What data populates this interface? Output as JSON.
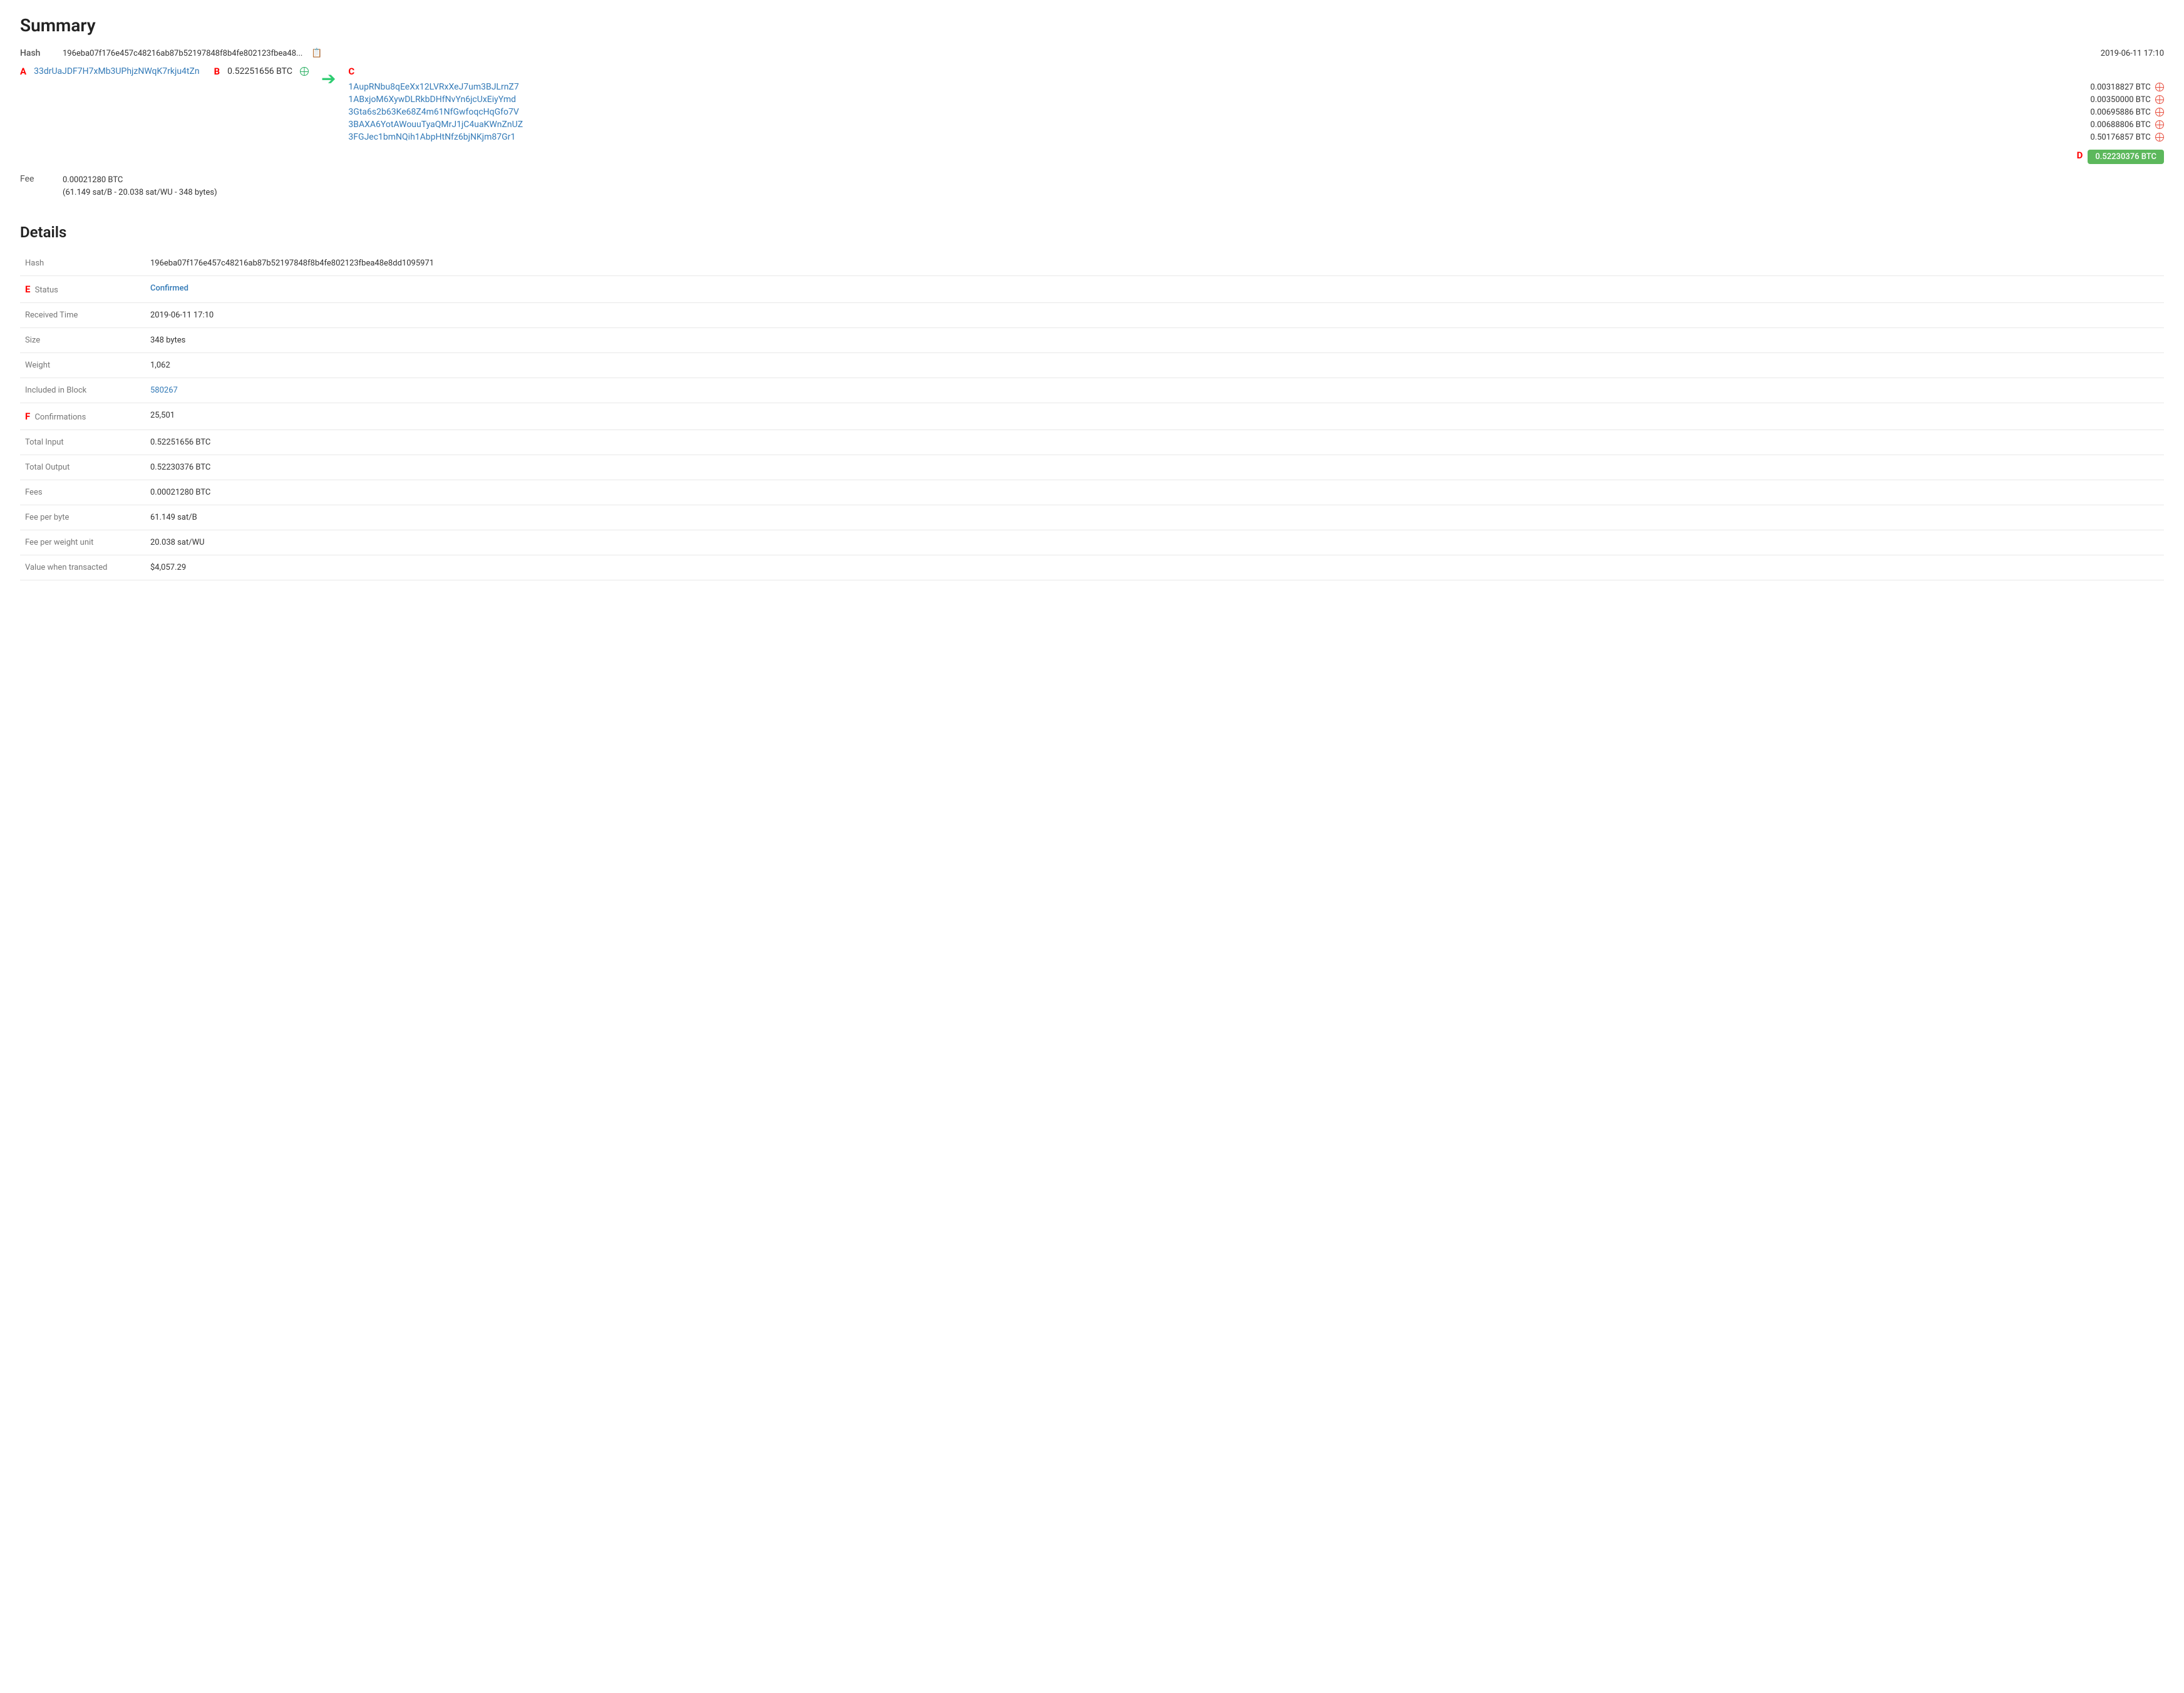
{
  "summary": {
    "title": "Summary",
    "hash_label": "Hash",
    "hash_value": "196eba07f176e457c48216ab87b52197848f8b4fe802123fbea48...",
    "hash_full": "196eba07f176e457c48216ab87b52197848f8b4fe802123fbea48e8dd1095971",
    "timestamp": "2019-06-11 17:10",
    "input_address": "33drUaJDF7H7xMb3UPhjzNWqK7rkju4tZn",
    "input_amount": "0.52251656 BTC",
    "marker_a": "A",
    "marker_b": "B",
    "marker_c": "C",
    "marker_d": "D",
    "outputs": [
      {
        "address": "1AupRNbu8qEeXx12LVRxXeJ7um3BJLrnZ7",
        "amount": "0.00318827 BTC"
      },
      {
        "address": "1ABxjoM6XywDLRkbDHfNvYn6jcUxEiyYmd",
        "amount": "0.00350000 BTC"
      },
      {
        "address": "3Gta6s2b63Ke68Z4m61NfGwfoqcHqGfo7V",
        "amount": "0.00695886 BTC"
      },
      {
        "address": "3BAXA6YotAWouuTyaQMrJ1jC4uaKWnZnUZ",
        "amount": "0.00688806 BTC"
      },
      {
        "address": "3FGJec1bmNQih1AbpHtNfz6bjNKjm87Gr1",
        "amount": "0.50176857 BTC"
      }
    ],
    "total_output_badge": "0.52230376 BTC",
    "fee_label": "Fee",
    "fee_value": "0.00021280 BTC",
    "fee_detail": "(61.149 sat/B - 20.038 sat/WU - 348 bytes)"
  },
  "details": {
    "title": "Details",
    "marker_e": "E",
    "marker_f": "F",
    "rows": [
      {
        "label": "Hash",
        "value": "196eba07f176e457c48216ab87b52197848f8b4fe802123fbea48e8dd1095971",
        "type": "text"
      },
      {
        "label": "Status",
        "value": "Confirmed",
        "type": "status"
      },
      {
        "label": "Received Time",
        "value": "2019-06-11 17:10",
        "type": "text"
      },
      {
        "label": "Size",
        "value": "348 bytes",
        "type": "text"
      },
      {
        "label": "Weight",
        "value": "1,062",
        "type": "text"
      },
      {
        "label": "Included in Block",
        "value": "580267",
        "type": "link"
      },
      {
        "label": "Confirmations",
        "value": "25,501",
        "type": "text"
      },
      {
        "label": "Total Input",
        "value": "0.52251656 BTC",
        "type": "text"
      },
      {
        "label": "Total Output",
        "value": "0.52230376 BTC",
        "type": "text"
      },
      {
        "label": "Fees",
        "value": "0.00021280 BTC",
        "type": "text"
      },
      {
        "label": "Fee per byte",
        "value": "61.149 sat/B",
        "type": "text"
      },
      {
        "label": "Fee per weight unit",
        "value": "20.038 sat/WU",
        "type": "text"
      },
      {
        "label": "Value when transacted",
        "value": "$4,057.29",
        "type": "text"
      }
    ]
  }
}
